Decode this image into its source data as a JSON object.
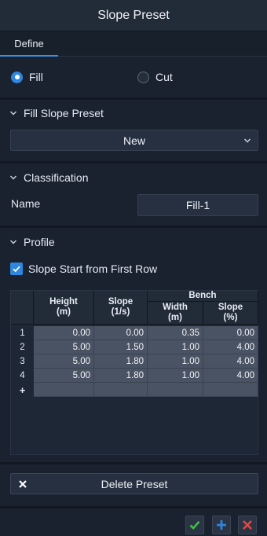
{
  "window": {
    "title": "Slope Preset"
  },
  "tabs": [
    {
      "label": "Define",
      "active": true
    }
  ],
  "mode": {
    "options": [
      {
        "label": "Fill",
        "checked": true
      },
      {
        "label": "Cut",
        "checked": false
      }
    ]
  },
  "fill_slope_preset": {
    "header": "Fill Slope Preset",
    "selected": "New"
  },
  "classification": {
    "header": "Classification",
    "name_label": "Name",
    "name_value": "Fill-1"
  },
  "profile": {
    "header": "Profile",
    "slope_start_label": "Slope Start from First Row",
    "slope_start_checked": true,
    "table": {
      "headers": {
        "height": "Height\n(m)",
        "slope": "Slope\n(1/s)",
        "bench": "Bench",
        "width": "Width\n(m)",
        "bench_slope": "Slope\n(%)"
      },
      "rows": [
        {
          "n": "1",
          "height": "0.00",
          "slope": "0.00",
          "width": "0.35",
          "bench_slope": "0.00"
        },
        {
          "n": "2",
          "height": "5.00",
          "slope": "1.50",
          "width": "1.00",
          "bench_slope": "4.00"
        },
        {
          "n": "3",
          "height": "5.00",
          "slope": "1.80",
          "width": "1.00",
          "bench_slope": "4.00"
        },
        {
          "n": "4",
          "height": "5.00",
          "slope": "1.80",
          "width": "1.00",
          "bench_slope": "4.00"
        }
      ],
      "new_row_marker": "+"
    }
  },
  "delete_preset_label": "Delete Preset",
  "colors": {
    "accent": "#2f86df",
    "ok": "#3fbf3f",
    "cancel": "#e34848"
  },
  "icons": [
    "chevron-down-icon",
    "close-icon",
    "check-icon",
    "plus-icon"
  ]
}
